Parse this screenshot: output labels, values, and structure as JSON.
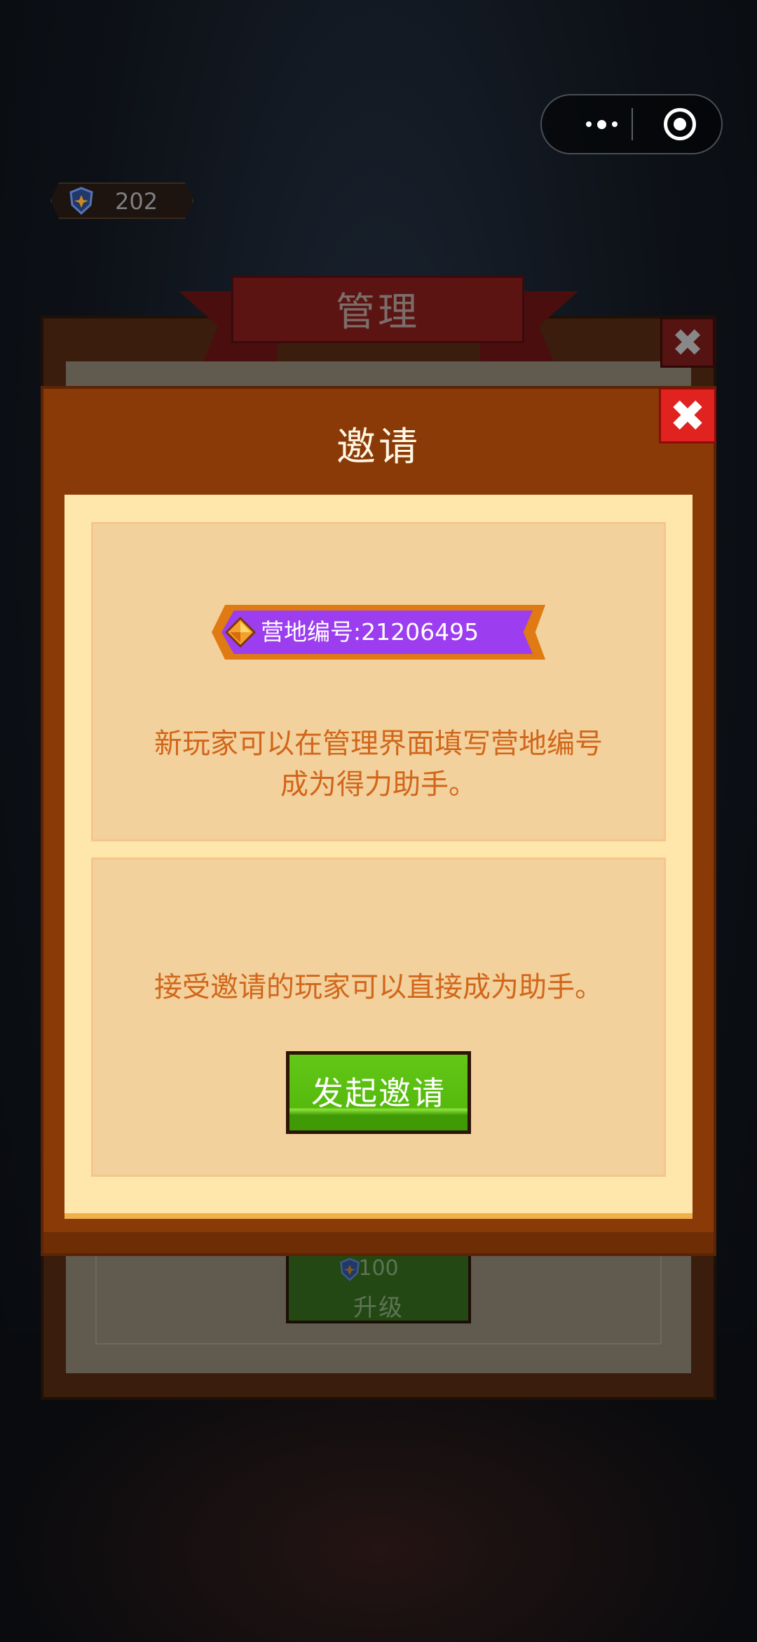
{
  "currency": {
    "value": "202",
    "icon": "shield-star-icon"
  },
  "background_panel": {
    "title": "管理",
    "upgrade_cost": "100",
    "upgrade_label": "升级"
  },
  "dialog": {
    "title": "邀请",
    "camp_id_label": "营地编号:21206495",
    "desc1_line1": "新玩家可以在管理界面填写营地编号",
    "desc1_line2": "成为得力助手。",
    "desc2": "接受邀请的玩家可以直接成为助手。",
    "invite_button": "发起邀请"
  },
  "colors": {
    "dialog_bg": "#8a3a06",
    "content_bg": "#ffe6ab",
    "card_bg": "#f2d19c",
    "text_orange": "#d2661a",
    "tag_purple": "#9c3ef0",
    "button_green": "#55ba0c",
    "close_red": "#e0231e"
  }
}
